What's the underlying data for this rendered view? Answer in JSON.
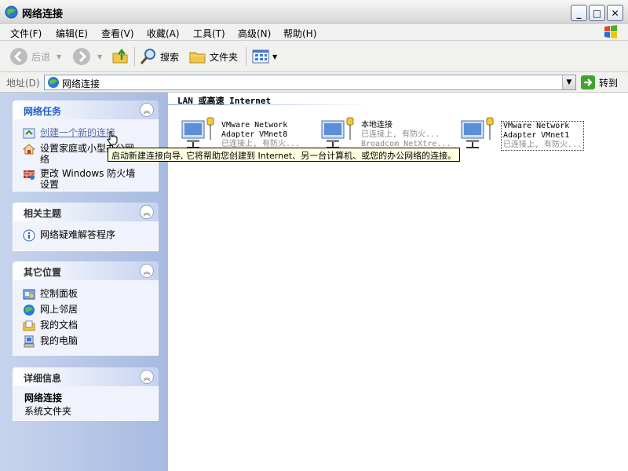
{
  "window": {
    "title": "网络连接",
    "controls": {
      "minimize": "_",
      "maximize": "□",
      "close": "✕"
    }
  },
  "menu": {
    "items": [
      "文件(F)",
      "编辑(E)",
      "查看(V)",
      "收藏(A)",
      "工具(T)",
      "高级(N)",
      "帮助(H)"
    ]
  },
  "toolbar": {
    "back_label": "后退",
    "search_label": "搜索",
    "folders_label": "文件夹"
  },
  "address": {
    "label": "地址(D)",
    "value": "网络连接",
    "go_label": "转到"
  },
  "sidebar": {
    "network_tasks": {
      "title": "网络任务",
      "items": [
        "创建一个新的连接",
        "设置家庭或小型办公网络",
        "更改 Windows 防火墙设置"
      ]
    },
    "related": {
      "title": "相关主题",
      "items": [
        "网络疑难解答程序"
      ]
    },
    "other_places": {
      "title": "其它位置",
      "items": [
        "控制面板",
        "网上邻居",
        "我的文档",
        "我的电脑"
      ]
    },
    "details": {
      "title": "详细信息",
      "name": "网络连接",
      "type": "系统文件夹"
    }
  },
  "main": {
    "group_title": "LAN 或高速 Internet",
    "connections": [
      {
        "line1": "VMware Network",
        "line2": "Adapter VMnet8",
        "status": "已连接上, 有防火..."
      },
      {
        "line1": "本地连接",
        "line2": "已连接上, 有防火...",
        "status": "Broadcom NetXtre..."
      },
      {
        "line1": "VMware Network",
        "line2": "Adapter VMnet1",
        "status": "已连接上, 有防火..."
      }
    ]
  },
  "tooltip": {
    "text": "启动新建连接向导, 它将帮助您创建到 Internet、另一台计算机、或您的办公网络的连接。"
  },
  "colors": {
    "pane_gradient_start": "#c7d4ed",
    "pane_gradient_end": "#a7bae0",
    "panel_title": "#215dc6",
    "tooltip_bg": "#ffffe1"
  }
}
